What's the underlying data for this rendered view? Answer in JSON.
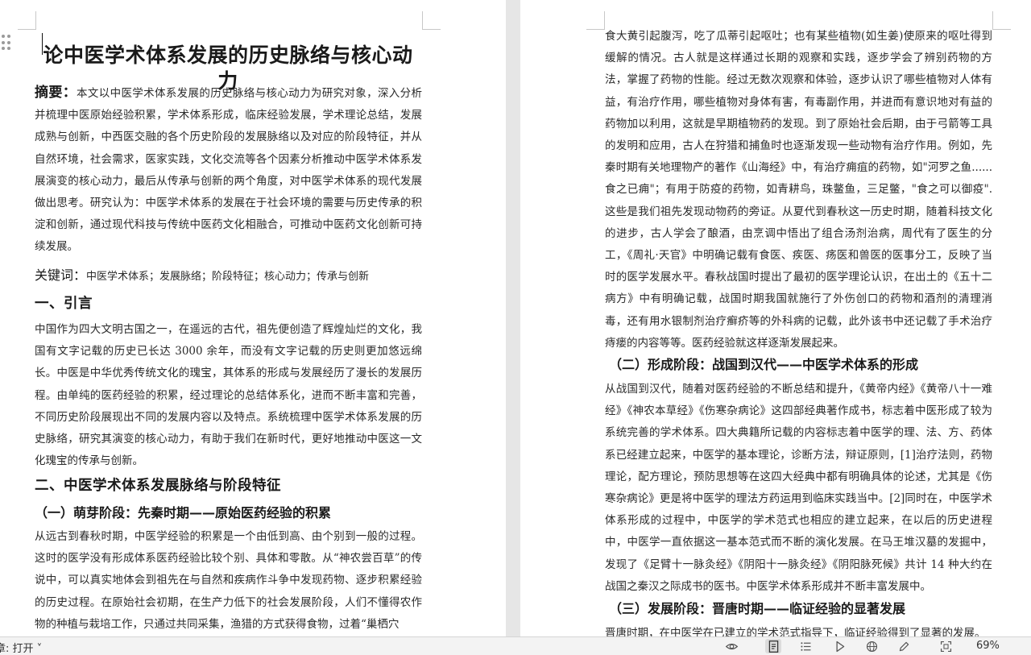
{
  "document": {
    "title": "论中医学术体系发展的历史脉络与核心动力",
    "abstract_label": "摘要：",
    "abstract_text": "本文以中医学术体系发展的历史脉络与核心动力为研究对象，深入分析并梳理中医原始经验积累，学术体系形成，临床经验发展，学术理论总结，发展成熟与创新，中西医交融的各个历史阶段的发展脉络以及对应的阶段特征，并从自然环境，社会需求，医家实践，文化交流等各个因素分析推动中医学术体系发展演变的核心动力，最后从传承与创新的两个角度，对中医学术体系的现代发展做出思考。研究认为：中医学术体系的发展在于社会环境的需要与历史传承的积淀和创新，通过现代科技与传统中医药文化相融合，可推动中医药文化创新可持续发展。",
    "keywords_label": "关键词：",
    "keywords_text": "中医学术体系；发展脉络；阶段特征；核心动力；传承与创新",
    "section1_heading": "一、引言",
    "section1_text": "中国作为四大文明古国之一，在遥远的古代，祖先便创造了辉煌灿烂的文化，我国有文字记载的历史已长达 3000 余年，而没有文字记载的历史则更加悠远绵长。中医是中华优秀传统文化的瑰宝，其体系的形成与发展经历了漫长的发展历程。由单纯的医药经验的积累，经过理论的总结体系化，进而不断丰富和完善，不同历史阶段展现出不同的发展内容以及特点。系统梳理中医学术体系发展的历史脉络，研究其演变的核心动力，有助于我们在新时代，更好地推动中医这一文化瑰宝的传承与创新。",
    "section2_heading": "二、中医学术体系发展脉络与阶段特征",
    "sub1_heading": "（一）萌芽阶段：先秦时期——原始医药经验的积累",
    "sub1_text": "从远古到春秋时期，中医学经验的积累是一个由低到高、由个别到一般的过程。这时的医学没有形成体系医药经验比较个别、具体和零散。从“神农尝百草”的传说中，可以真实地体会到祖先在与自然和疾病作斗争中发现药物、逐步积累经验的历史过程。在原始社会初期，在生产力低下的社会发展阶段，人们不懂得农作物的种植与栽培工作，只通过共同采集，渔猎的方式获得食物，过着“巢栖穴",
    "right_text_1": "食大黄引起腹泻，吃了瓜蒂引起呕吐；也有某些植物(如生姜)使原来的呕吐得到缓解的情况。古人就是这样通过长期的观察和实践，逐步学会了辨别药物的方法，掌握了药物的性能。经过无数次观察和体验，逐步认识了哪些植物对人体有益，有治疗作用，哪些植物对身体有害，有毒副作用，并进而有意识地对有益的药物加以利用，这就是早期植物药的发现。到了原始社会后期，由于弓箭等工具的发明和应用，古人在狩猎和捕鱼时也逐渐发现一些动物有治疗作用。例如，先秦时期有关地理物产的著作《山海经》中，有治疗痈疽的药物，如\"河罗之鱼......食之已痈\"；有用于防疫的药物，如青耕鸟，珠鳖鱼，三足鳖，\"食之可以御疫\".这些是我们祖先发现动物药的旁证。从夏代到春秋这一历史时期，随着科技文化的进步，古人学会了酿酒，由烹调中悟出了组合汤剂治病，周代有了医生的分工，《周礼·天官》中明确记载有食医、疾医、疡医和兽医的医事分工，反映了当时的医学发展水平。春秋战国时提出了最初的医学理论认识，在出土的《五十二病方》中有明确记载，战国时期我国就施行了外伤创口的药物和酒剂的清理消毒，还有用水银制剂治疗癣疥等的外科病的记载，此外该书中还记载了手术治疗痔瘘的内容等等。医药经验就这样逐渐发展起来。",
    "sub2_heading": "（二）形成阶段：战国到汉代——中医学术体系的形成",
    "sub2_text": "从战国到汉代，随着对医药经验的不断总结和提升，《黄帝内经》《黄帝八十一难经》《神农本草经》《伤寒杂病论》这四部经典著作成书，标志着中医形成了较为系统完善的学术体系。四大典籍所记载的内容标志着中医学的理、法、方、药体系已经建立起来，中医学的基本理论，诊断方法，辩证原则，[1]治疗法则，药物理论，配方理论，预防思想等在这四大经典中都有明确具体的论述，尤其是《伤寒杂病论》更是将中医学的理法方药运用到临床实践当中。[2]同时在，中医学术体系形成的过程中，中医学的学术范式也相应的建立起来，在以后的历史进程中，中医学一直依据这一基本范式而不断的演化发展。在马王堆汉墓的发掘中，发现了《足臂十一脉灸经》《阴阳十一脉灸经》《阴阳脉死候》共计 14 种大约在战国之秦汉之际成书的医书。中医学术体系形成并不断丰富发展中。",
    "sub3_heading": "（三）发展阶段：晋唐时期——临证经验的显著发展",
    "sub3_text": "晋唐时期，在中医学在已建立的学术范式指导下，临证经验得到了显著的发展。"
  },
  "status_bar": {
    "text": "章: 打开 ˅",
    "zoom": "69%",
    "icons": [
      "eye-icon",
      "page-view-icon",
      "outline-icon",
      "play-icon",
      "web-view-icon",
      "pen-icon",
      "fit-screen-icon"
    ]
  }
}
